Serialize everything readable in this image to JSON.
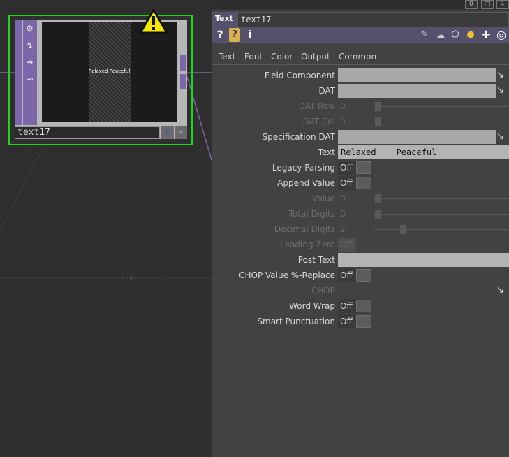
{
  "node": {
    "name": "text17",
    "viewer_text": "Relaxed    Peaceful",
    "side_icons": [
      "gear-icon",
      "export-icon",
      "arrow-right-icon",
      "lock-open-icon"
    ]
  },
  "panel": {
    "op_type": "Text",
    "op_name": "text17",
    "header_buttons": [
      "0",
      "□",
      "⇩"
    ],
    "tabs": [
      "Text",
      "Font",
      "Color",
      "Output",
      "Common"
    ],
    "params": {
      "field_component": {
        "label": "Field Component"
      },
      "dat": {
        "label": "DAT"
      },
      "dat_row": {
        "label": "DAT Row",
        "value": "0"
      },
      "dat_col": {
        "label": "DAT Col",
        "value": "0"
      },
      "specification_dat": {
        "label": "Specification DAT"
      },
      "text": {
        "label": "Text",
        "value": "Relaxed    Peaceful"
      },
      "legacy_parsing": {
        "label": "Legacy Parsing",
        "value": "Off"
      },
      "append_value": {
        "label": "Append Value",
        "value": "Off"
      },
      "value": {
        "label": "Value",
        "value": "0"
      },
      "total_digits": {
        "label": "Total Digits",
        "value": "0"
      },
      "decimal_digits": {
        "label": "Decimal Digits",
        "value": "2"
      },
      "leading_zero": {
        "label": "Leading Zero",
        "value": "Off"
      },
      "post_text": {
        "label": "Post Text",
        "value": ""
      },
      "chop_value_replace": {
        "label": "CHOP Value %-Replace",
        "value": "Off"
      },
      "chop": {
        "label": "CHOP"
      },
      "word_wrap": {
        "label": "Word Wrap",
        "value": "Off"
      },
      "smart_punctuation": {
        "label": "Smart Punctuation",
        "value": "Off"
      }
    }
  },
  "colors": {
    "node_border": "#1fd51f",
    "op_purple": "#7a66a8",
    "title_bar": "#55506b",
    "warning": "#f5e600"
  }
}
